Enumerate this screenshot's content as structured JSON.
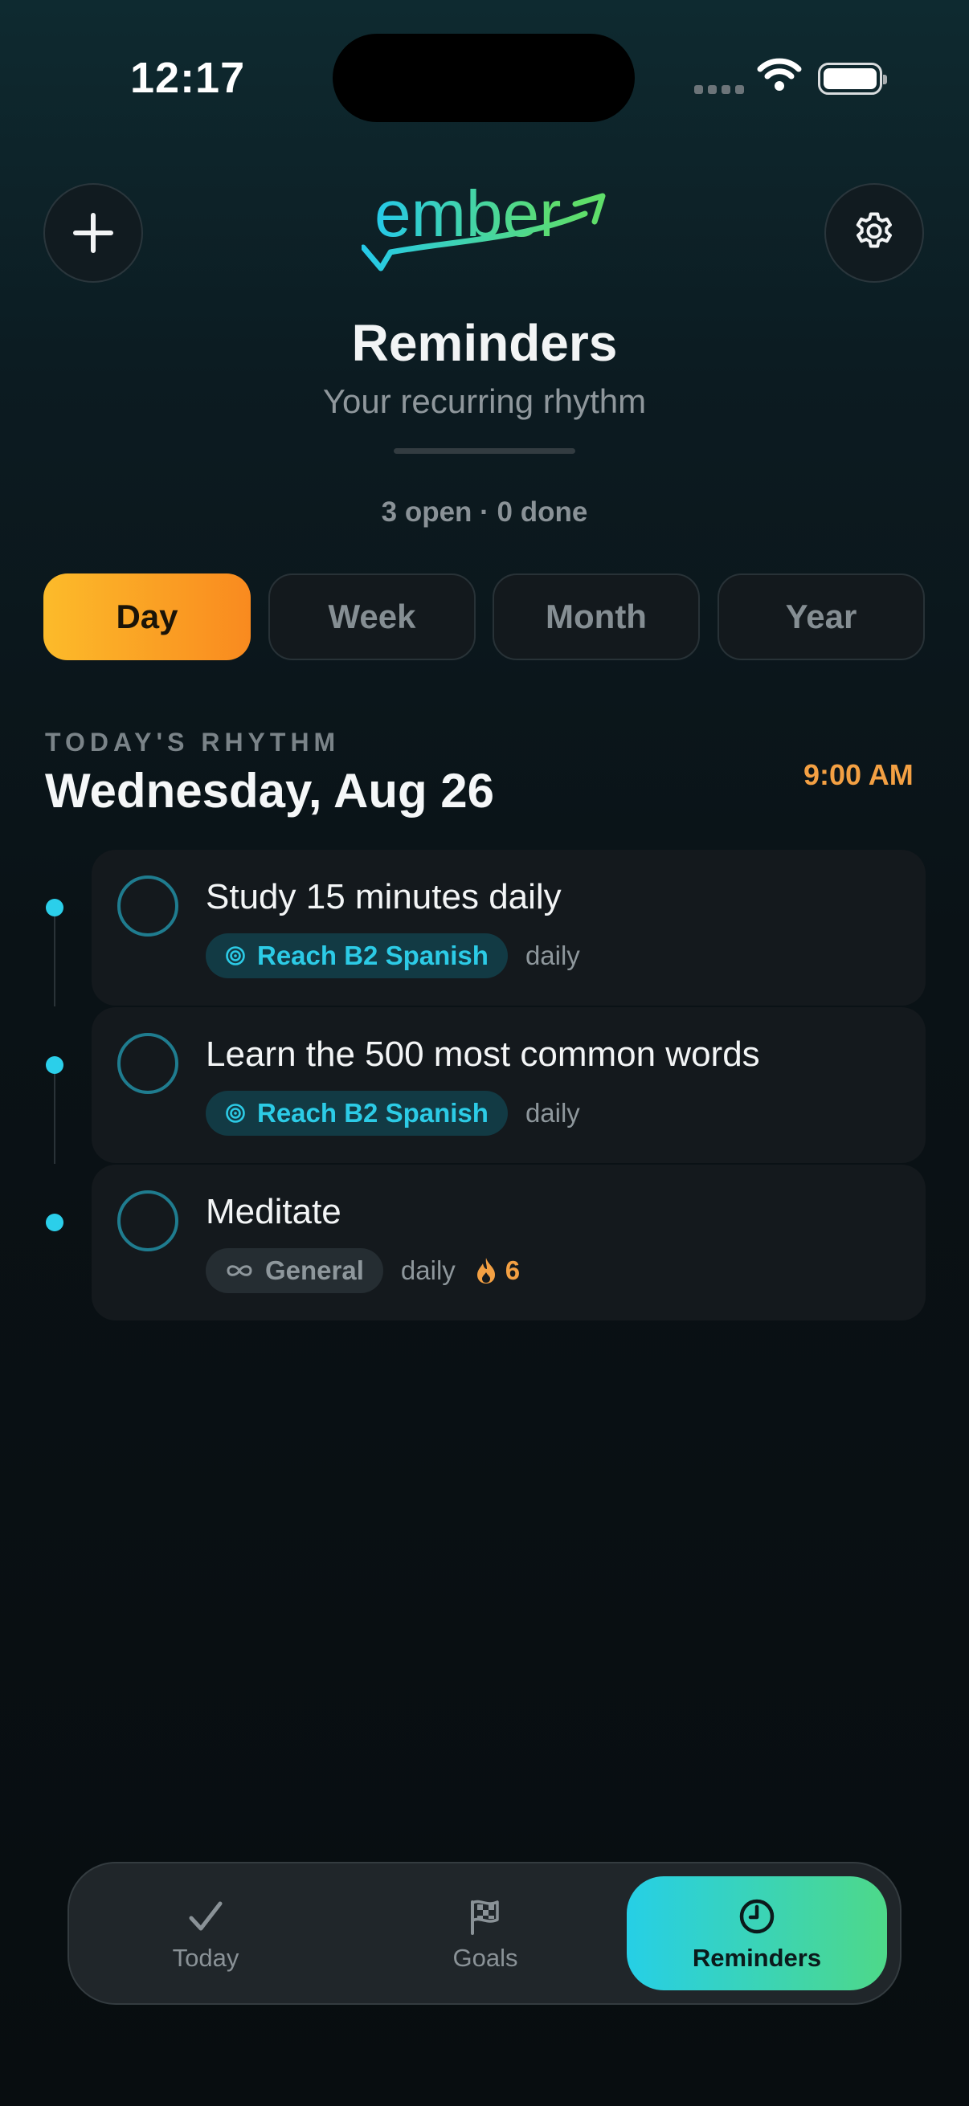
{
  "status_bar": {
    "time": "12:17"
  },
  "header": {
    "logo_text": "ember",
    "title": "Reminders",
    "subtitle": "Your recurring rhythm",
    "summary": "3 open · 0 done"
  },
  "segments": [
    {
      "label": "Day",
      "active": true
    },
    {
      "label": "Week",
      "active": false
    },
    {
      "label": "Month",
      "active": false
    },
    {
      "label": "Year",
      "active": false
    }
  ],
  "section": {
    "label": "TODAY'S RHYTHM",
    "date": "Wednesday, Aug 26",
    "time": "9:00 AM"
  },
  "reminders": [
    {
      "title": "Study 15 minutes daily",
      "tag": "Reach B2 Spanish",
      "tag_icon": "target-icon",
      "frequency": "daily"
    },
    {
      "title": "Learn the 500 most common words",
      "tag": "Reach B2 Spanish",
      "tag_icon": "target-icon",
      "frequency": "daily"
    },
    {
      "title": "Meditate",
      "tag": "General",
      "tag_icon": "infinity-icon",
      "frequency": "daily",
      "streak": "6"
    }
  ],
  "tabs": [
    {
      "label": "Today",
      "icon": "checkmark-icon",
      "active": false
    },
    {
      "label": "Goals",
      "icon": "flag-icon",
      "active": false
    },
    {
      "label": "Reminders",
      "icon": "clock-icon",
      "active": true
    }
  ],
  "colors": {
    "accent_cyan": "#2bcfea",
    "accent_orange": "#f98a1f",
    "streak_orange": "#f3a043"
  }
}
